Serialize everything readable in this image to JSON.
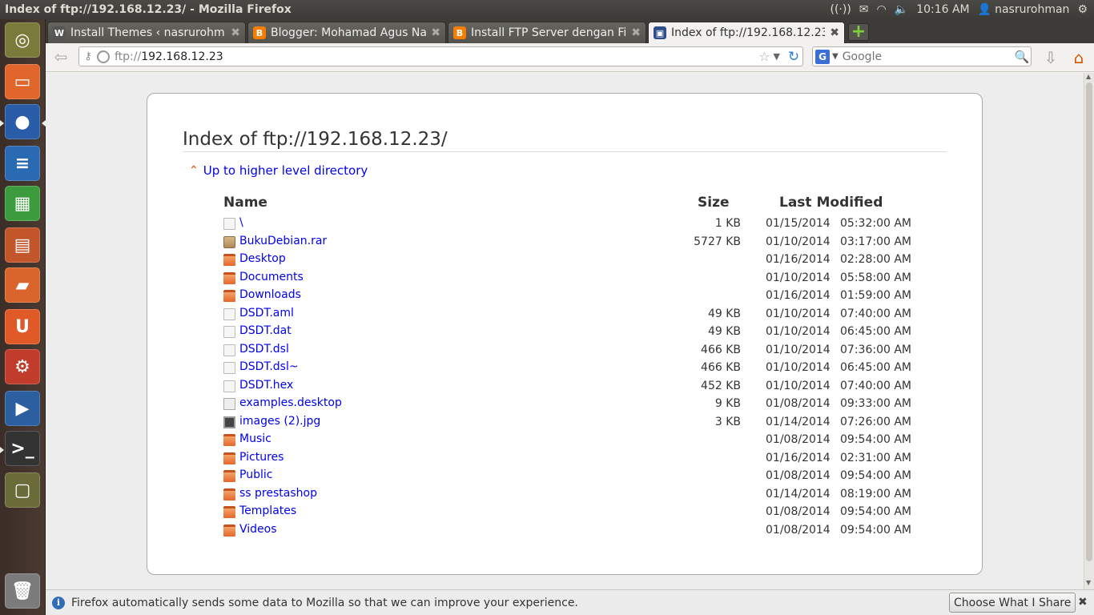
{
  "window": {
    "title": "Index of ftp://192.168.12.23/ - Mozilla Firefox"
  },
  "panel": {
    "clock": "10:16 AM",
    "user": "nasrurohman"
  },
  "tabs": [
    {
      "label": "Install Themes ‹ nasrurohm...",
      "icon": "wordpress-icon"
    },
    {
      "label": "Blogger: Mohamad Agus Na...",
      "icon": "blogger-icon"
    },
    {
      "label": "Install FTP Server dengan Fi...",
      "icon": "blogger-icon"
    },
    {
      "label": "Index of ftp://192.168.12.23/",
      "icon": "monitor-icon",
      "active": true
    }
  ],
  "urlbar": {
    "scheme": "ftp://",
    "host": "192.168.12.23"
  },
  "search": {
    "placeholder": "Google",
    "engine": "G"
  },
  "page": {
    "heading": "Index of ftp://192.168.12.23/",
    "up_link": "Up to higher level directory",
    "columns": {
      "name": "Name",
      "size": "Size",
      "modified": "Last Modified"
    }
  },
  "files": [
    {
      "name": "\\",
      "type": "file",
      "size": "1 KB",
      "date": "01/15/2014",
      "time": "05:32:00 AM"
    },
    {
      "name": "BukuDebian.rar",
      "type": "archive",
      "size": "5727 KB",
      "date": "01/10/2014",
      "time": "03:17:00 AM"
    },
    {
      "name": "Desktop",
      "type": "folder",
      "size": "",
      "date": "01/16/2014",
      "time": "02:28:00 AM"
    },
    {
      "name": "Documents",
      "type": "folder",
      "size": "",
      "date": "01/10/2014",
      "time": "05:58:00 AM"
    },
    {
      "name": "Downloads",
      "type": "folder",
      "size": "",
      "date": "01/16/2014",
      "time": "01:59:00 AM"
    },
    {
      "name": "DSDT.aml",
      "type": "file",
      "size": "49 KB",
      "date": "01/10/2014",
      "time": "07:40:00 AM"
    },
    {
      "name": "DSDT.dat",
      "type": "file",
      "size": "49 KB",
      "date": "01/10/2014",
      "time": "06:45:00 AM"
    },
    {
      "name": "DSDT.dsl",
      "type": "file",
      "size": "466 KB",
      "date": "01/10/2014",
      "time": "07:36:00 AM"
    },
    {
      "name": "DSDT.dsl~",
      "type": "file",
      "size": "466 KB",
      "date": "01/10/2014",
      "time": "06:45:00 AM"
    },
    {
      "name": "DSDT.hex",
      "type": "file",
      "size": "452 KB",
      "date": "01/10/2014",
      "time": "07:40:00 AM"
    },
    {
      "name": "examples.desktop",
      "type": "desktop",
      "size": "9 KB",
      "date": "01/08/2014",
      "time": "09:33:00 AM"
    },
    {
      "name": "images (2).jpg",
      "type": "image",
      "size": "3 KB",
      "date": "01/14/2014",
      "time": "07:26:00 AM"
    },
    {
      "name": "Music",
      "type": "folder",
      "size": "",
      "date": "01/08/2014",
      "time": "09:54:00 AM"
    },
    {
      "name": "Pictures",
      "type": "folder",
      "size": "",
      "date": "01/16/2014",
      "time": "02:31:00 AM"
    },
    {
      "name": "Public",
      "type": "folder",
      "size": "",
      "date": "01/08/2014",
      "time": "09:54:00 AM"
    },
    {
      "name": "ss prestashop",
      "type": "folder",
      "size": "",
      "date": "01/14/2014",
      "time": "08:19:00 AM"
    },
    {
      "name": "Templates",
      "type": "folder",
      "size": "",
      "date": "01/08/2014",
      "time": "09:54:00 AM"
    },
    {
      "name": "Videos",
      "type": "folder",
      "size": "",
      "date": "01/08/2014",
      "time": "09:54:00 AM"
    }
  ],
  "notification": {
    "message": "Firefox automatically sends some data to Mozilla so that we can improve your experience.",
    "button": "Choose What I Share"
  },
  "launcher": [
    {
      "name": "dash-home",
      "color": "#7a7a3a"
    },
    {
      "name": "files",
      "color": "#e0662c"
    },
    {
      "name": "firefox",
      "color": "#2a5da8"
    },
    {
      "name": "libreoffice-writer",
      "color": "#2a6ab3"
    },
    {
      "name": "libreoffice-calc",
      "color": "#3c9b3c"
    },
    {
      "name": "libreoffice-impress",
      "color": "#c2562a"
    },
    {
      "name": "software-center",
      "color": "#d9642c"
    },
    {
      "name": "ubuntu-one",
      "color": "#e05a28"
    },
    {
      "name": "system-settings",
      "color": "#c23c2c"
    },
    {
      "name": "media-app",
      "color": "#2c5fa0"
    },
    {
      "name": "terminal",
      "color": "#333333"
    },
    {
      "name": "workspace-switcher",
      "color": "#6b6b3a"
    },
    {
      "name": "trash",
      "color": "#7b7b7b"
    }
  ]
}
